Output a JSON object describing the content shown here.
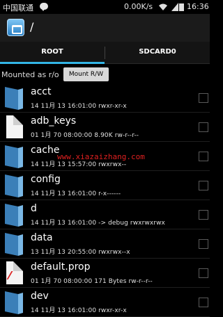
{
  "status_bar": {
    "carrier": "中国联通",
    "speed": "0.00K/s",
    "time": "16:36"
  },
  "title_bar": {
    "path": "/"
  },
  "tabs": [
    {
      "label": "ROOT"
    },
    {
      "label": "SDCARD0"
    }
  ],
  "mount": {
    "label": "Mounted as r/o",
    "button": "Mount R/W"
  },
  "files": [
    {
      "name": "acct",
      "meta": "14 11月 13 16:01:00   rwxr-xr-x",
      "type": "folder"
    },
    {
      "name": "adb_keys",
      "meta": "01 1月 70 08:00:00  8.90K  rw-r--r--",
      "type": "file"
    },
    {
      "name": "cache",
      "meta": "14 11月 13 15:57:00   rwxrwx--",
      "type": "folder"
    },
    {
      "name": "config",
      "meta": "14 11月 13 16:01:00   r-x------",
      "type": "folder"
    },
    {
      "name": "d",
      "meta": "14 11月 13 16:01:00  -> debug  rwxrwxrwx",
      "type": "folder"
    },
    {
      "name": "data",
      "meta": "13 11月 13 20:55:00   rwxrwx--x",
      "type": "folder"
    },
    {
      "name": "default.prop",
      "meta": "01 1月 70 08:00:00  171 Bytes  rw-r--r--",
      "type": "prop"
    },
    {
      "name": "dev",
      "meta": "14 11月 13 16:01:00   rwxr-xr-x",
      "type": "folder"
    }
  ],
  "watermark": "www.xiazaizhang.com"
}
